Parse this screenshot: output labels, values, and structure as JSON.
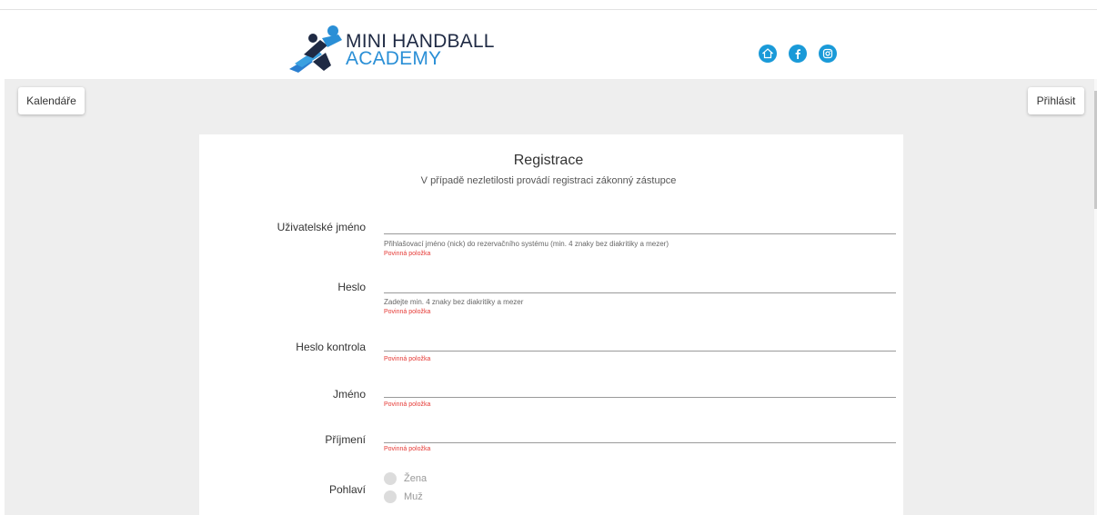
{
  "header": {
    "logo": {
      "line1": "MINI HANDBALL",
      "line2": "ACADEMY"
    },
    "social_icons": [
      "home-icon",
      "facebook-icon",
      "instagram-icon"
    ],
    "accent_color": "#1a9ad8"
  },
  "nav": {
    "calendar_label": "Kalendáře",
    "login_label": "Přihlásit"
  },
  "form": {
    "title": "Registrace",
    "subtitle": "V případě nezletilosti provádí registraci zákonný zástupce",
    "fields": {
      "username": {
        "label": "Uživatelské jméno",
        "value": "",
        "hint": "Přihlašovací jméno (nick) do rezervačního systému (min. 4 znaky bez diakritiky a mezer)",
        "required": "Povinná položka"
      },
      "password": {
        "label": "Heslo",
        "value": "",
        "hint": "Zadejte min. 4 znaky bez diakritiky a mezer",
        "required": "Povinná položka"
      },
      "password_check": {
        "label": "Heslo kontrola",
        "value": "",
        "required": "Povinná položka"
      },
      "first_name": {
        "label": "Jméno",
        "value": "",
        "required": "Povinná položka"
      },
      "last_name": {
        "label": "Příjmení",
        "value": "",
        "required": "Povinná položka"
      },
      "gender": {
        "label": "Pohlaví",
        "options": [
          "Žena",
          "Muž"
        ]
      }
    },
    "error_color": "#e53935"
  }
}
